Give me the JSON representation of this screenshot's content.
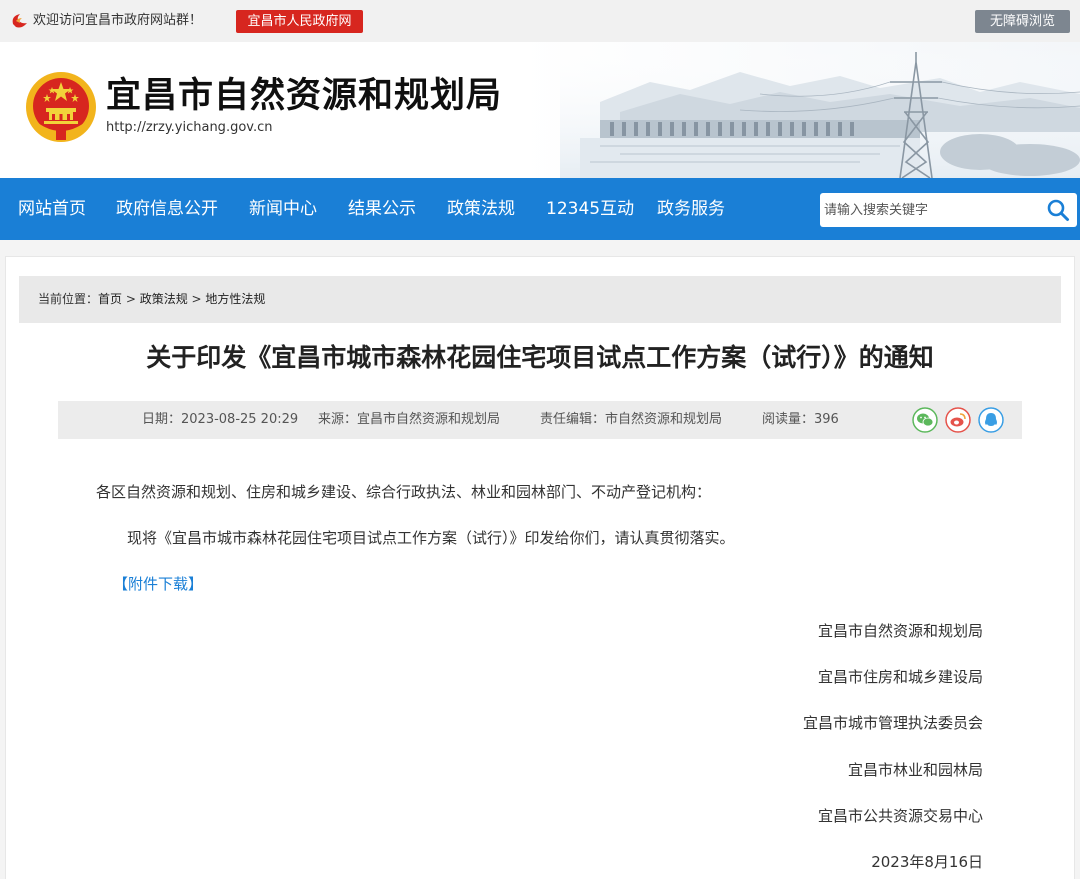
{
  "topbar": {
    "welcome": "欢迎访问宜昌市政府网站群！",
    "gov_link": "宜昌市人民政府网",
    "accessibility": "无障碍浏览"
  },
  "header": {
    "site_name": "宜昌市自然资源和规划局",
    "site_url": "http://zrzy.yichang.gov.cn"
  },
  "nav": {
    "items": [
      {
        "label": "网站首页"
      },
      {
        "label": "政府信息公开"
      },
      {
        "label": "新闻中心"
      },
      {
        "label": "结果公示"
      },
      {
        "label": "政策法规"
      },
      {
        "label": "12345互动"
      },
      {
        "label": "政务服务"
      }
    ],
    "search_placeholder": "请输入搜索关键字"
  },
  "breadcrumb": {
    "prefix": "当前位置：",
    "items": [
      "首页",
      "政策法规",
      "地方性法规"
    ],
    "separator": " > "
  },
  "article": {
    "title": "关于印发《宜昌市城市森林花园住宅项目试点工作方案（试行）》的通知",
    "meta": {
      "date": "日期：2023-08-25 20:29",
      "source": "来源：宜昌市自然资源和规划局",
      "editor": "责任编辑：市自然资源和规划局",
      "views": "阅读量：396"
    },
    "share": {
      "wechat_color": "#5cb85c",
      "weibo_color": "#e5534b",
      "qq_color": "#3a9ee4"
    },
    "salutation": "各区自然资源和规划、住房和城乡建设、综合行政执法、林业和园林部门、不动产登记机构：",
    "body": "现将《宜昌市城市森林花园住宅项目试点工作方案（试行）》印发给你们，请认真贯彻落实。",
    "attachment": "【附件下载】",
    "signatories": [
      "宜昌市自然资源和规划局",
      "宜昌市住房和城乡建设局",
      "宜昌市城市管理执法委员会",
      "宜昌市林业和园林局",
      "宜昌市公共资源交易中心"
    ],
    "date_signed": "2023年8月16日"
  }
}
